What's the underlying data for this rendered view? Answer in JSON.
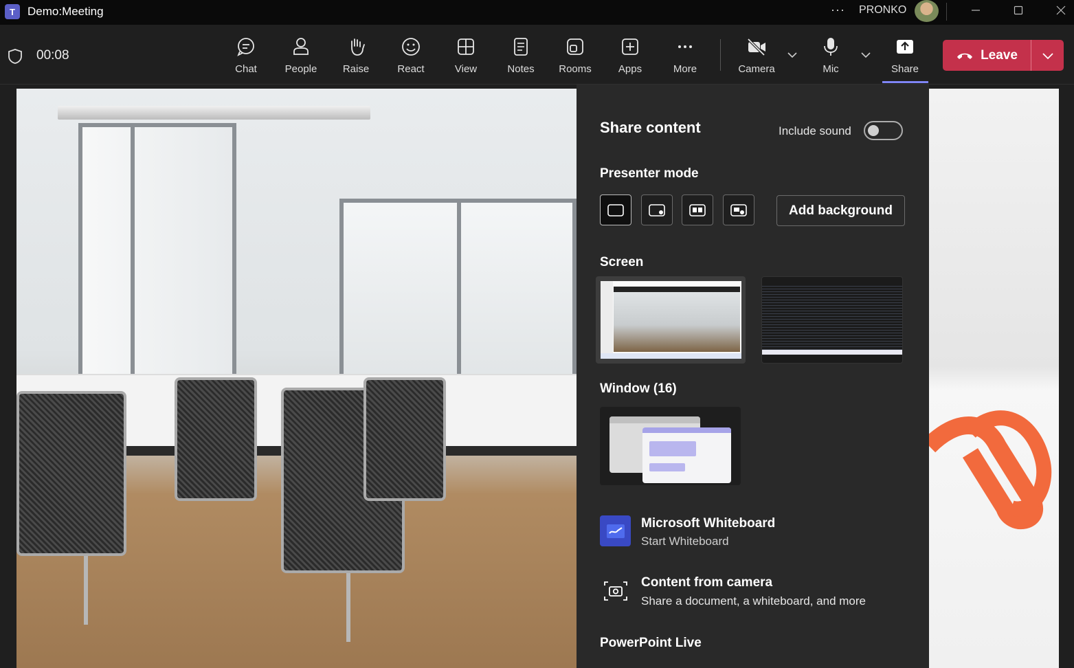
{
  "title_bar": {
    "app_icon": "teams-icon",
    "window_title": "Demo:Meeting",
    "more_label": "···",
    "user_name": "PRONKO"
  },
  "toolbar": {
    "timer": "00:08",
    "items": [
      {
        "label": "Chat",
        "icon": "chat-icon"
      },
      {
        "label": "People",
        "icon": "people-icon"
      },
      {
        "label": "Raise",
        "icon": "hand-icon"
      },
      {
        "label": "React",
        "icon": "smiley-icon"
      },
      {
        "label": "View",
        "icon": "grid-icon"
      },
      {
        "label": "Notes",
        "icon": "notes-icon"
      },
      {
        "label": "Rooms",
        "icon": "rooms-icon"
      },
      {
        "label": "Apps",
        "icon": "plus-box-icon"
      },
      {
        "label": "More",
        "icon": "more-icon"
      }
    ],
    "camera_label": "Camera",
    "mic_label": "Mic",
    "share_label": "Share",
    "leave_label": "Leave",
    "colors": {
      "leave": "#c4314b",
      "accent": "#7f85f5"
    }
  },
  "share_panel": {
    "title": "Share content",
    "include_sound_label": "Include sound",
    "include_sound_on": false,
    "presenter_mode_heading": "Presenter mode",
    "presenter_modes": [
      "content-only",
      "standout",
      "side-by-side",
      "reporter"
    ],
    "add_background_label": "Add background",
    "screen_heading": "Screen",
    "window_heading": "Window (16)",
    "whiteboard_title": "Microsoft Whiteboard",
    "whiteboard_sub": "Start Whiteboard",
    "camera_content_title": "Content from camera",
    "camera_content_sub": "Share a document, a whiteboard, and more",
    "powerpoint_heading": "PowerPoint Live"
  }
}
